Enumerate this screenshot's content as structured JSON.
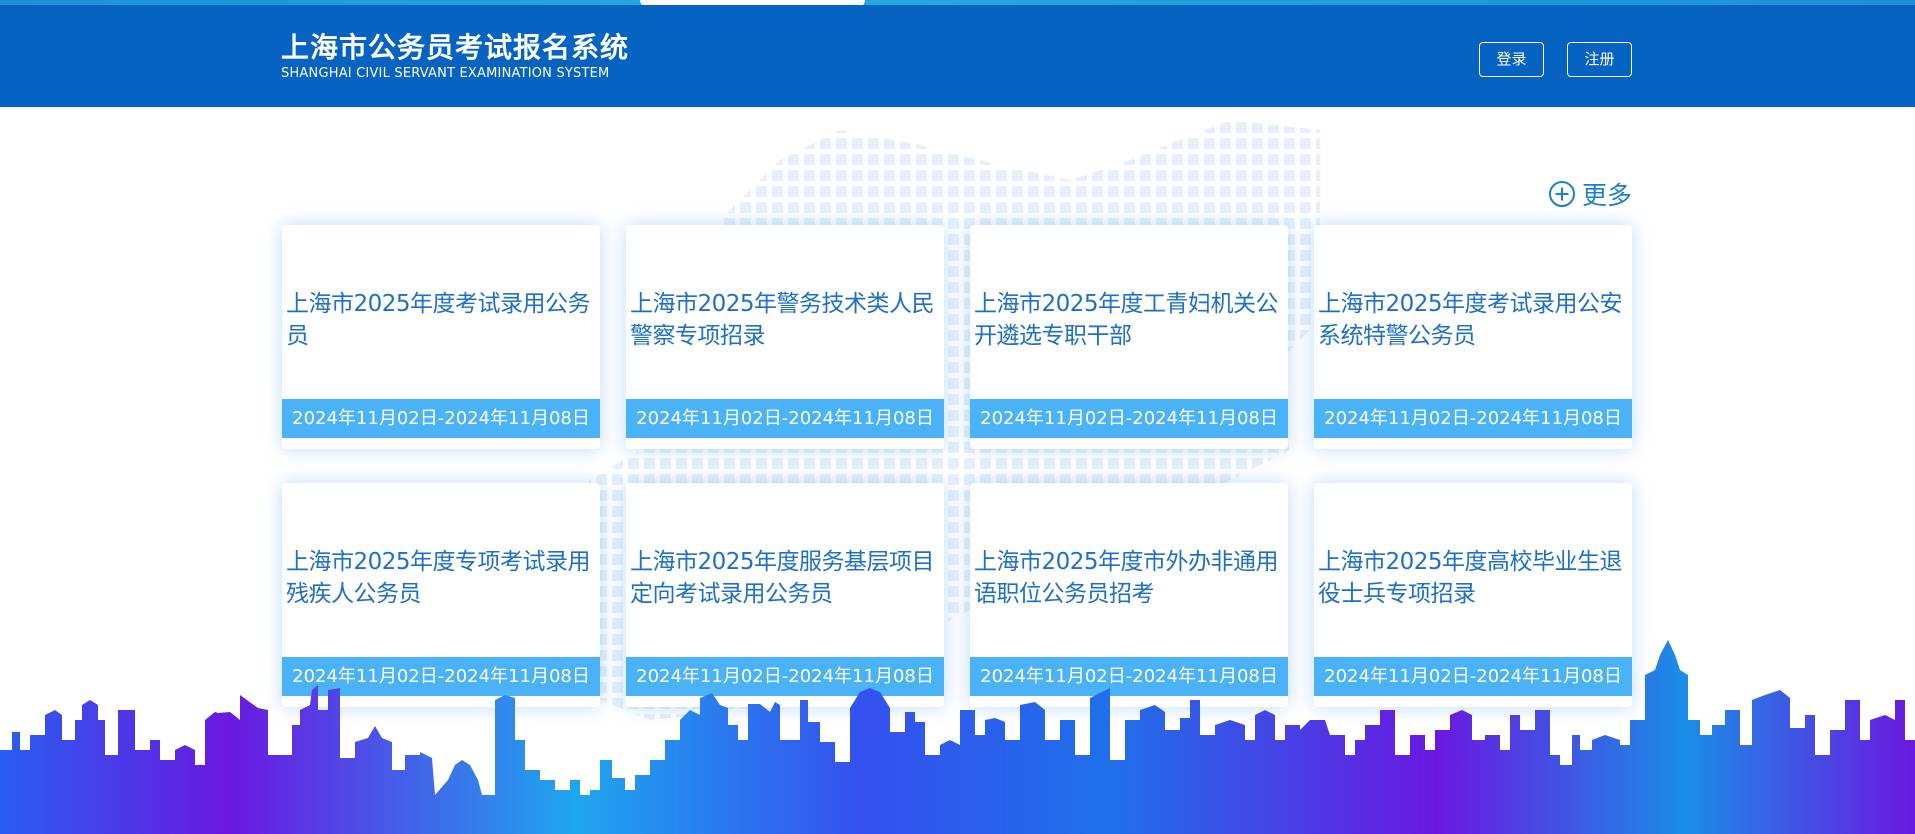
{
  "header": {
    "title": "上海市公务员考试报名系统",
    "subtitle": "SHANGHAI CIVIL SERVANT EXAMINATION SYSTEM",
    "login_label": "登录",
    "register_label": "注册"
  },
  "more": {
    "label": "更多",
    "icon": "plus-circle-icon"
  },
  "cards": [
    {
      "title": "上海市2025年度考试录用公务员",
      "date": "2024年11月02日-2024年11月08日"
    },
    {
      "title": "上海市2025年警务技术类人民警察专项招录",
      "date": "2024年11月02日-2024年11月08日"
    },
    {
      "title": "上海市2025年度工青妇机关公开遴选专职干部",
      "date": "2024年11月02日-2024年11月08日"
    },
    {
      "title": "上海市2025年度考试录用公安系统特警公务员",
      "date": "2024年11月02日-2024年11月08日"
    },
    {
      "title": "上海市2025年度专项考试录用残疾人公务员",
      "date": "2024年11月02日-2024年11月08日"
    },
    {
      "title": "上海市2025年度服务基层项目定向考试录用公务员",
      "date": "2024年11月02日-2024年11月08日"
    },
    {
      "title": "上海市2025年度市外办非通用语职位公务员招考",
      "date": "2024年11月02日-2024年11月08日"
    },
    {
      "title": "上海市2025年度高校毕业生退役士兵专项招录",
      "date": "2024年11月02日-2024年11月08日"
    }
  ],
  "colors": {
    "header_bg": "#0663c2",
    "card_title": "#1e70c4",
    "date_bar": "#4ab3f7",
    "skyline_blue": "#1a8de6",
    "skyline_purple": "#6a18e0"
  }
}
